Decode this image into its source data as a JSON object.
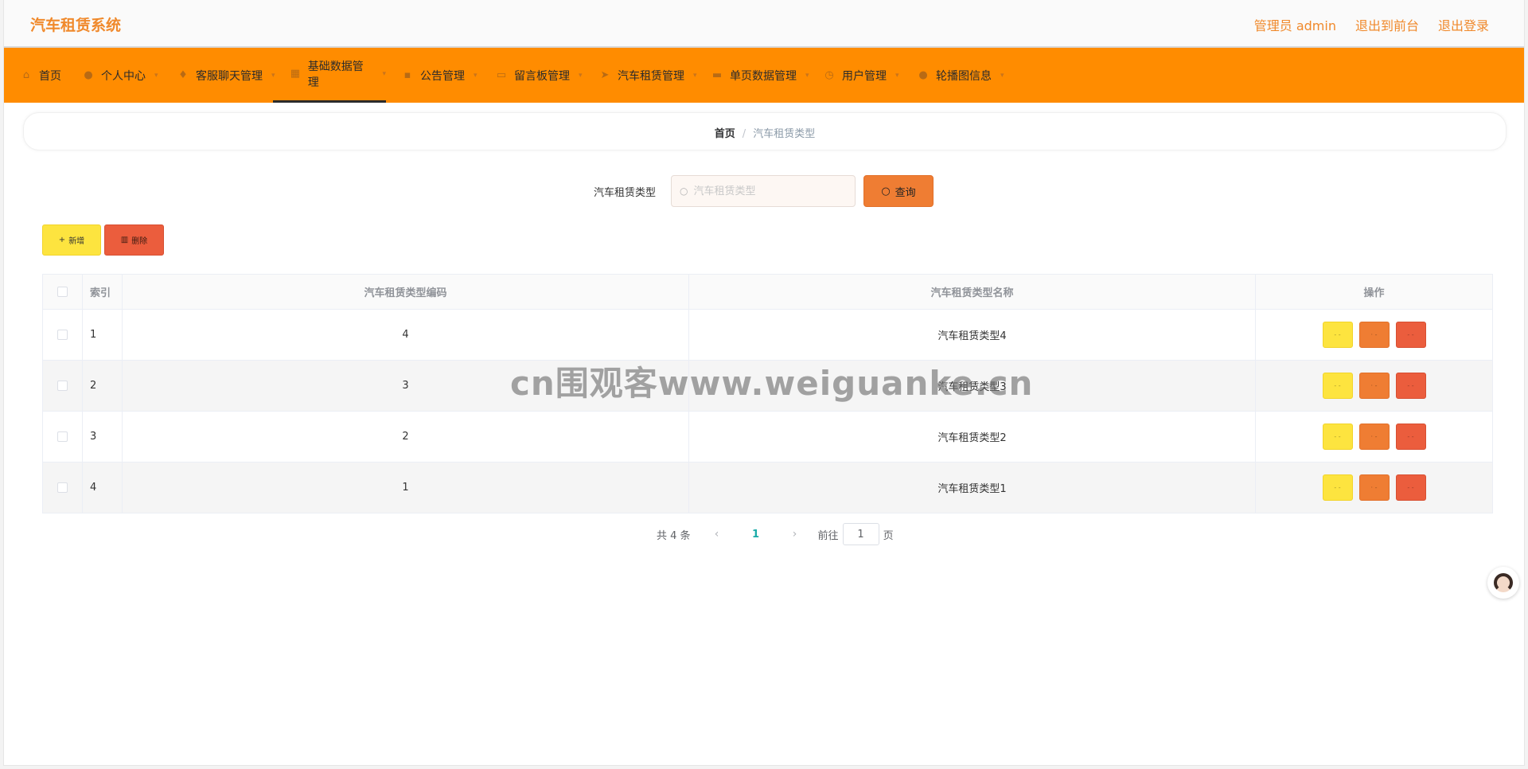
{
  "app": {
    "title": "汽车租赁系统"
  },
  "header": {
    "user_label": "管理员 admin",
    "to_front": "退出到前台",
    "logout": "退出登录"
  },
  "nav": {
    "items": [
      {
        "label": "首页",
        "icon": "home-icon"
      },
      {
        "label": "个人中心",
        "icon": "user-icon"
      },
      {
        "label": "客服聊天管理",
        "icon": "pin-icon"
      },
      {
        "label": "基础数据管理",
        "icon": "grid-icon",
        "active": true
      },
      {
        "label": "公告管理",
        "icon": "apps-icon"
      },
      {
        "label": "留言板管理",
        "icon": "message-icon"
      },
      {
        "label": "汽车租赁管理",
        "icon": "navigation-icon"
      },
      {
        "label": "单页数据管理",
        "icon": "ticket-icon"
      },
      {
        "label": "用户管理",
        "icon": "clock-icon"
      },
      {
        "label": "轮播图信息",
        "icon": "user-icon"
      }
    ]
  },
  "breadcrumb": {
    "home": "首页",
    "separator": "/",
    "current": "汽车租赁类型"
  },
  "search": {
    "label": "汽车租赁类型",
    "placeholder": "汽车租赁类型",
    "value": "",
    "button": "查询"
  },
  "toolbar": {
    "add_label": "新增",
    "delete_label": "删除"
  },
  "table": {
    "headers": {
      "index": "索引",
      "code": "汽车租赁类型编码",
      "name": "汽车租赁类型名称",
      "actions": "操作"
    },
    "rows": [
      {
        "index": "1",
        "code": "4",
        "name": "汽车租赁类型4"
      },
      {
        "index": "2",
        "code": "3",
        "name": "汽车租赁类型3"
      },
      {
        "index": "3",
        "code": "2",
        "name": "汽车租赁类型2"
      },
      {
        "index": "4",
        "code": "1",
        "name": "汽车租赁类型1"
      }
    ],
    "action_labels": [
      "- -",
      "· -",
      "- -"
    ]
  },
  "pagination": {
    "total": "共 4 条",
    "current_page": "1",
    "goto_label": "前往",
    "goto_value": "1",
    "page_suffix": "页"
  },
  "watermark": "cn围观客www.weiguanke.cn",
  "colors": {
    "brand": "#f0892b",
    "nav_bg": "#ff8c00",
    "yellow_btn": "#fde43f",
    "orange_btn": "#ef7d33",
    "red_btn": "#eb5d3d",
    "page_active": "#1aaba8"
  }
}
